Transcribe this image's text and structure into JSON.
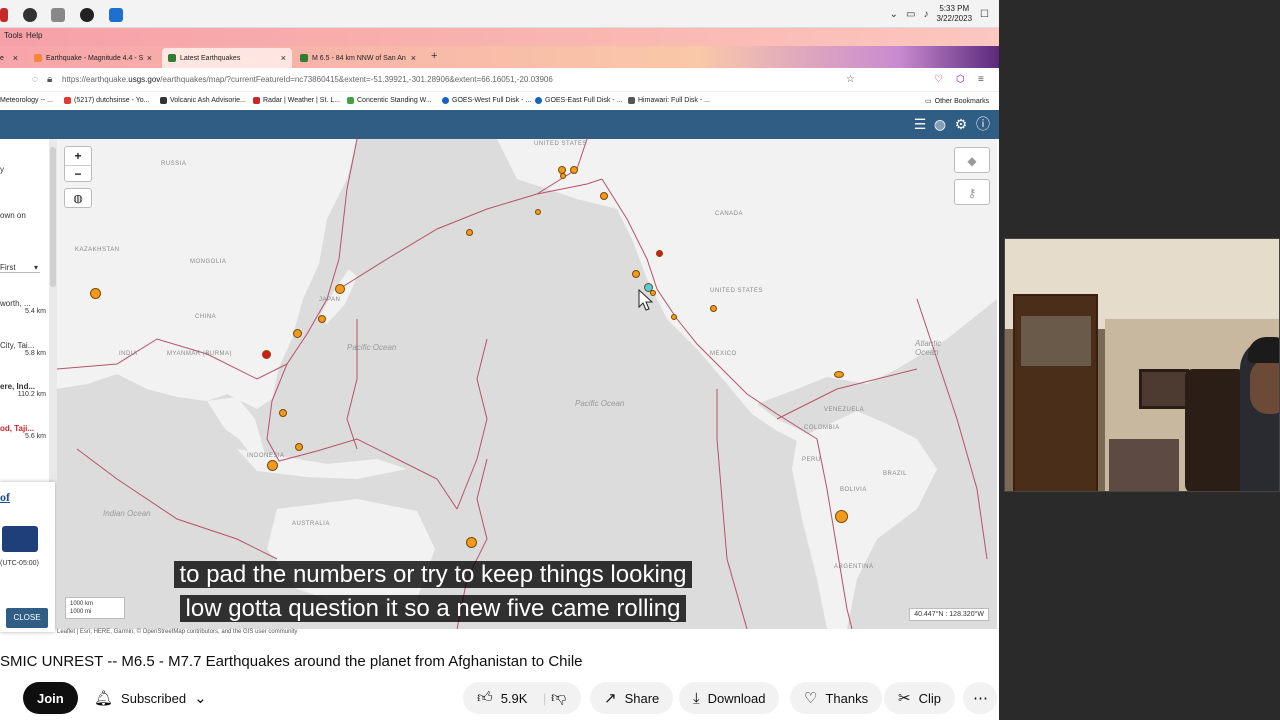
{
  "taskbar": {
    "time": "5:33 PM",
    "date": "3/22/2023"
  },
  "menu": {
    "tools": "Tools",
    "help": "Help"
  },
  "tabs": [
    {
      "label": "e"
    },
    {
      "label": "Earthquake - Magnitude 4.4 - S"
    },
    {
      "label": "Latest Earthquakes"
    },
    {
      "label": "M 6.5 - 84 km NNW of San An"
    }
  ],
  "url": {
    "prefix": "https://earthquake.",
    "domain": "usgs.gov",
    "path": "/earthquakes/map/?currentFeatureId=nc73860415&extent=-51.39921,-301.28906&extent=66.16051,-20.03906"
  },
  "bookmarks": [
    {
      "label": "Meteorology -- ..."
    },
    {
      "label": "(5217) dutchsinse - Yo..."
    },
    {
      "label": "Volcanic Ash Advisorie..."
    },
    {
      "label": "Radar | Weather | St. L..."
    },
    {
      "label": "Concentic Standing W..."
    },
    {
      "label": "GOES-West Full Disk - ..."
    },
    {
      "label": "GOES-East Full Disk - ..."
    },
    {
      "label": "Himawari: Full Disk - ..."
    },
    {
      "label": "Other Bookmarks"
    }
  ],
  "left_panel": {
    "fragment1": "y",
    "fragment2": "own on",
    "sort": "First",
    "items": [
      {
        "place": "worth, ...",
        "dist": "5.4 km"
      },
      {
        "place": "City, Tai...",
        "dist": "5.8 km"
      },
      {
        "place": "ere, Ind...",
        "dist": "110.2 km"
      },
      {
        "place": "od, Taji...",
        "dist": "5.6 km"
      }
    ],
    "card_link": "of",
    "timezone": "(UTC-05:00)",
    "close": "CLOSE"
  },
  "map": {
    "labels": {
      "russia": "RUSSIA",
      "kazakhstan": "KAZAKHSTAN",
      "mongolia": "MONGOLIA",
      "china": "CHINA",
      "india": "INDIA",
      "myanmar": "MYANMAR (BURMA)",
      "japan": "JAPAN",
      "indonesia": "INDONESIA",
      "australia": "AUSTRALIA",
      "united_states_top": "UNITED STATES",
      "canada": "CANADA",
      "united_states": "UNITED STATES",
      "mexico": "MEXICO",
      "venezuela": "VENEZUELA",
      "colombia": "COLOMBIA",
      "peru": "PERU",
      "brazil": "BRAZIL",
      "bolivia": "BOLIVIA",
      "argentina": "ARGENTINA",
      "pacific1": "Pacific Ocean",
      "pacific2": "Pacific Ocean",
      "indian": "Indian Ocean",
      "atlantic": "Atlantic Ocean"
    },
    "coords": "40.447°N : 128.320°W",
    "scale_km": "1000 km",
    "scale_mi": "1000 mi",
    "attribution": "Leaflet | Esri, HERE, Garmin, © OpenStreetMap contributors, and the GIS user community",
    "colors": {
      "orange": "#f39a1e",
      "red": "#d7191c",
      "cyan": "#4dd0e1",
      "plate": "#b5536a"
    }
  },
  "caption": {
    "line1": "to pad the numbers or try to keep things looking",
    "line2": "low gotta question it so a new five came rolling"
  },
  "youtube": {
    "title": "SMIC UNREST -- M6.5 - M7.7 Earthquakes around the planet from Afghanistan to Chile",
    "join": "Join",
    "subscribed": "Subscribed",
    "likes": "5.9K",
    "share": "Share",
    "download": "Download",
    "thanks": "Thanks",
    "clip": "Clip"
  }
}
